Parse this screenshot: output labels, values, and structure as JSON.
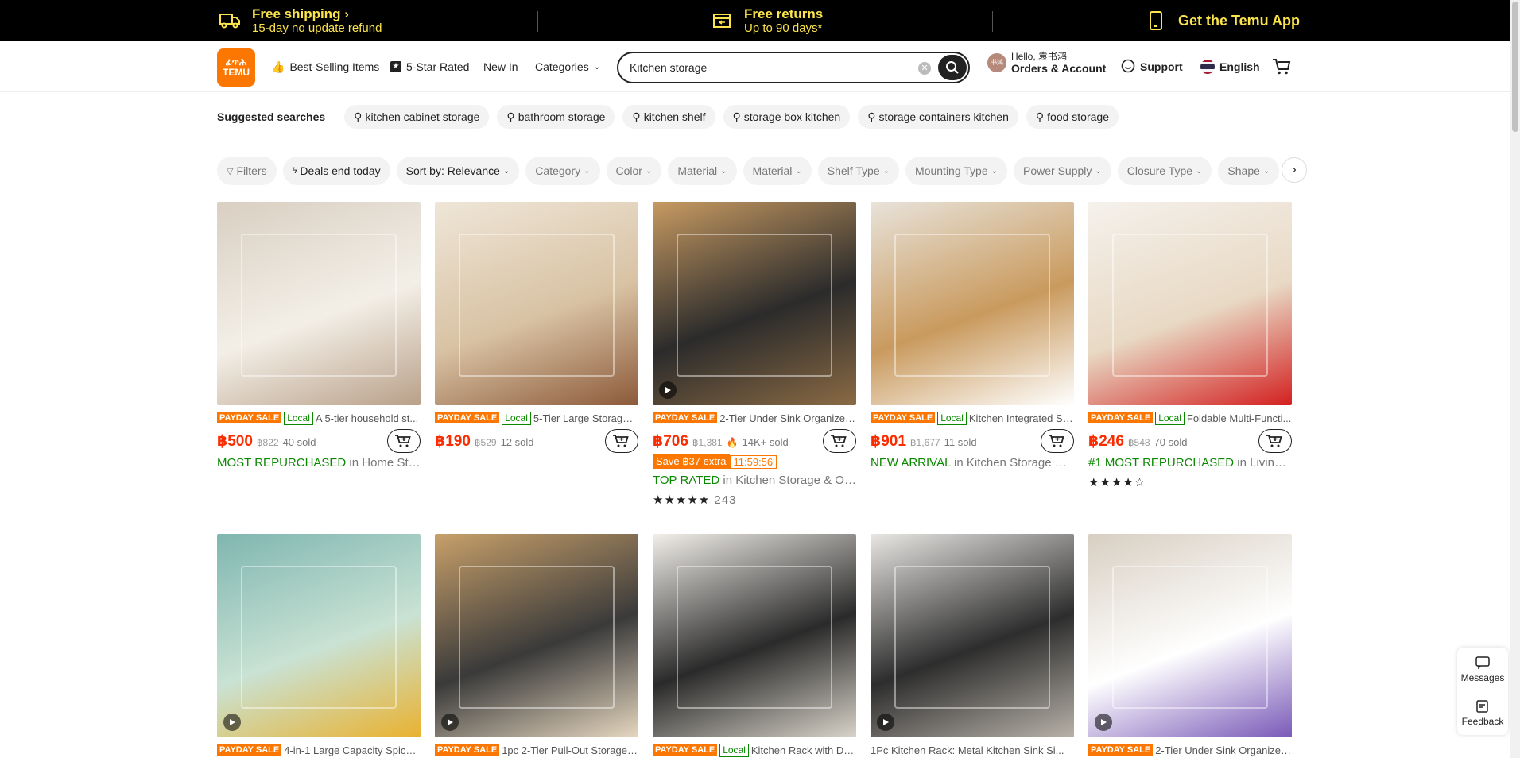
{
  "topbar": {
    "shipping_title": "Free shipping",
    "shipping_sub": "15-day no update refund",
    "returns_title": "Free returns",
    "returns_sub": "Up to 90 days*",
    "app_title": "Get the Temu App"
  },
  "header": {
    "logo_line1": "ፊጥሕ",
    "logo_line2": "TEMU",
    "nav": [
      "Best-Selling Items",
      "5-Star Rated",
      "New In",
      "Categories"
    ],
    "search_value": "Kitchen storage",
    "account_greeting": "Hello, 袁书鸿",
    "account_label": "Orders & Account",
    "avatar_text": "书鸿",
    "support": "Support",
    "language": "English"
  },
  "suggest": {
    "label": "Suggested searches",
    "items": [
      "kitchen cabinet storage",
      "bathroom storage",
      "kitchen shelf",
      "storage box kitchen",
      "storage containers kitchen",
      "food storage"
    ]
  },
  "filters": [
    "Filters",
    "Deals end today",
    "Sort by: Relevance",
    "Category",
    "Color",
    "Material",
    "Material",
    "Shelf Type",
    "Mounting Type",
    "Power Supply",
    "Closure Type",
    "Shape"
  ],
  "products": [
    {
      "sale": "PAYDAY SALE",
      "local": "Local",
      "title": "A 5-tier household st...",
      "price": "฿500",
      "old": "฿822",
      "sold": "40 sold",
      "tag_bold": "MOST REPURCHASED",
      "tag_rest": " in Home Stor...",
      "video": false,
      "colors": [
        "#d9cfc2",
        "#f3efe7",
        "#b9a089"
      ]
    },
    {
      "sale": "PAYDAY SALE",
      "local": "Local",
      "title": "5-Tier Large Storage ...",
      "price": "฿190",
      "old": "฿529",
      "sold": "12 sold",
      "tag_bold": "",
      "tag_rest": "",
      "video": false,
      "colors": [
        "#efe6d8",
        "#d8c2a3",
        "#8c5a3a"
      ]
    },
    {
      "sale": "PAYDAY SALE",
      "local": "",
      "title": "2-Tier Under Sink Organizer...",
      "price": "฿706",
      "old": "฿1,381",
      "sold": "14K+ sold",
      "save": "Save ฿37 extra",
      "timer": "11:59:56",
      "tag_bold": "TOP RATED",
      "tag_rest": " in Kitchen Storage & Or...",
      "stars": "★★★★★",
      "reviews": "243",
      "video": true,
      "colors": [
        "#c79a62",
        "#2b2b2b",
        "#8a6a44"
      ]
    },
    {
      "sale": "PAYDAY SALE",
      "local": "Local",
      "title": "Kitchen Integrated St...",
      "price": "฿901",
      "old": "฿1,677",
      "sold": "11 sold",
      "tag_bold": "NEW ARRIVAL",
      "tag_rest": " in Kitchen Storage & ...",
      "video": false,
      "colors": [
        "#e8e3da",
        "#c99a5e",
        "#ffffff"
      ]
    },
    {
      "sale": "PAYDAY SALE",
      "local": "Local",
      "title": "Foldable Multi-Functi...",
      "price": "฿246",
      "old": "฿548",
      "sold": "70 sold",
      "tag_bold": "#1 MOST REPURCHASED",
      "tag_rest": " in Living R...",
      "stars": "★★★★☆",
      "video": false,
      "colors": [
        "#f5f1ec",
        "#e8d9c4",
        "#d32020"
      ]
    },
    {
      "sale": "PAYDAY SALE",
      "local": "",
      "title": "4-in-1 Large Capacity Spice ...",
      "video": true,
      "colors": [
        "#7fb6b0",
        "#c9e2d4",
        "#e9b230"
      ]
    },
    {
      "sale": "PAYDAY SALE",
      "local": "",
      "title": "1pc 2-Tier Pull-Out Storage ...",
      "video": true,
      "colors": [
        "#c8a06a",
        "#3a3a3a",
        "#e6d7bf"
      ]
    },
    {
      "sale": "PAYDAY SALE",
      "local": "Local",
      "title": "Kitchen Rack with Dis...",
      "video": false,
      "colors": [
        "#f2efea",
        "#2a2a2a",
        "#d8d3c9"
      ]
    },
    {
      "sale": "",
      "local": "",
      "title": "1Pc Kitchen Rack: Metal Kitchen Sink Si...",
      "video": true,
      "colors": [
        "#e9e7e4",
        "#2d2d2d",
        "#b7b1a8"
      ]
    },
    {
      "sale": "PAYDAY SALE",
      "local": "",
      "title": "2-Tier Under Sink Organizer...",
      "video": true,
      "colors": [
        "#d8cfc2",
        "#ffffff",
        "#7a5ab8"
      ]
    }
  ],
  "side": {
    "messages": "Messages",
    "feedback": "Feedback"
  }
}
